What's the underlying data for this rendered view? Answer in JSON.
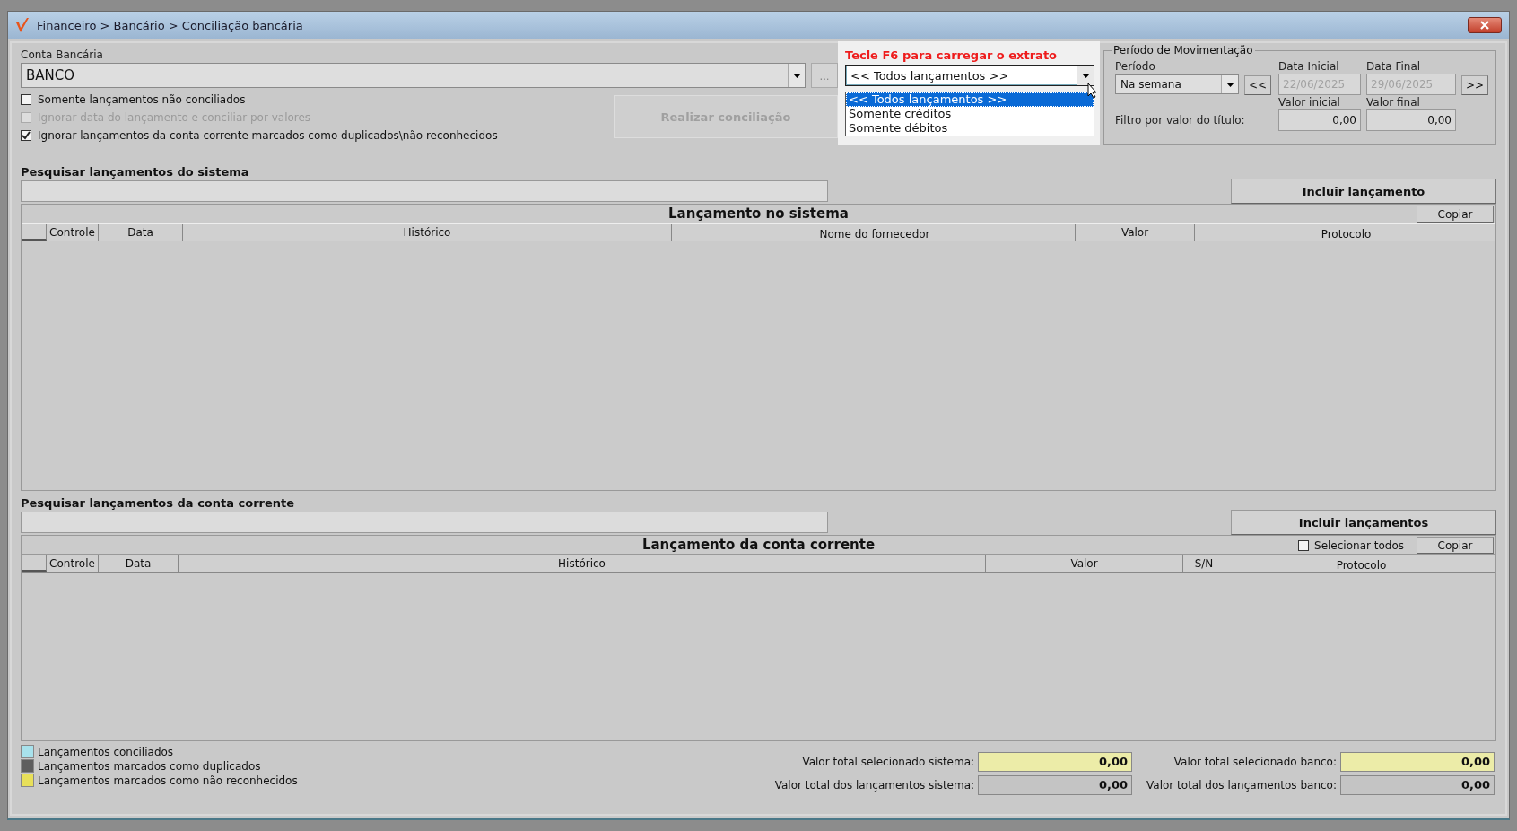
{
  "window": {
    "title": "Financeiro > Bancário > Conciliação bancária"
  },
  "account": {
    "label": "Conta Bancária",
    "value": "BANCO",
    "button": "..."
  },
  "options": [
    {
      "label": "Somente lançamentos não conciliados",
      "checked": false,
      "disabled": false
    },
    {
      "label": "Ignorar data do lançamento e conciliar por valores",
      "checked": false,
      "disabled": true
    },
    {
      "label": "Ignorar lançamentos da conta corrente marcados como duplicados\\não reconhecidos",
      "checked": true,
      "disabled": false
    }
  ],
  "reconcile_button": {
    "label": "Realizar conciliação",
    "disabled": true
  },
  "statement_filter": {
    "hint": "Tecle F6 para carregar o extrato",
    "value": "<< Todos lançamentos >>",
    "expanded": true,
    "options": [
      {
        "label": "<< Todos lançamentos >>",
        "selected": true
      },
      {
        "label": "Somente créditos",
        "selected": false
      },
      {
        "label": "Somente débitos",
        "selected": false
      }
    ]
  },
  "period_group": {
    "title": "Período de Movimentação",
    "period_label": "Período",
    "period_value": "Na semana",
    "start": {
      "label": "Data Inicial",
      "value": "22/06/2025",
      "disabled": true
    },
    "end": {
      "label": "Data Final",
      "value": "29/06/2025",
      "disabled": true
    },
    "prev_button": "<<",
    "next_button": ">>",
    "value_filter_label": "Filtro por valor do título:",
    "min": {
      "label": "Valor inicial",
      "value": "0,00"
    },
    "max": {
      "label": "Valor final",
      "value": "0,00"
    }
  },
  "system_section": {
    "search_label": "Pesquisar lançamentos do sistema",
    "add_button": "Incluir lançamento",
    "table": {
      "title": "Lançamento no sistema",
      "copy_button": "Copiar",
      "columns": [
        "Controle",
        "Data",
        "Histórico",
        "Nome do fornecedor",
        "Valor",
        "Protocolo"
      ]
    }
  },
  "bank_section": {
    "search_label": "Pesquisar lançamentos da conta corrente",
    "add_button": "Incluir lançamentos",
    "table": {
      "title": "Lançamento da conta corrente",
      "select_all": {
        "label": "Selecionar todos",
        "checked": false
      },
      "copy_button": "Copiar",
      "columns": [
        "Controle",
        "Data",
        "Histórico",
        "Valor",
        "S/N",
        "Protocolo"
      ]
    }
  },
  "legend": [
    {
      "label": "Lançamentos conciliados",
      "color": "#a8e2ec"
    },
    {
      "label": "Lançamentos marcados como duplicados",
      "color": "#5e5e5e"
    },
    {
      "label": "Lançamentos marcados como não reconhecidos",
      "color": "#e8e05a"
    }
  ],
  "totals": [
    {
      "label": "Valor total selecionado sistema:",
      "value": "0,00",
      "highlighted": true
    },
    {
      "label": "Valor total selecionado banco:",
      "value": "0,00",
      "highlighted": true
    },
    {
      "label": "Valor total dos lançamentos sistema:",
      "value": "0,00",
      "highlighted": false
    },
    {
      "label": "Valor total dos lançamentos banco:",
      "value": "0,00",
      "highlighted": false
    }
  ]
}
